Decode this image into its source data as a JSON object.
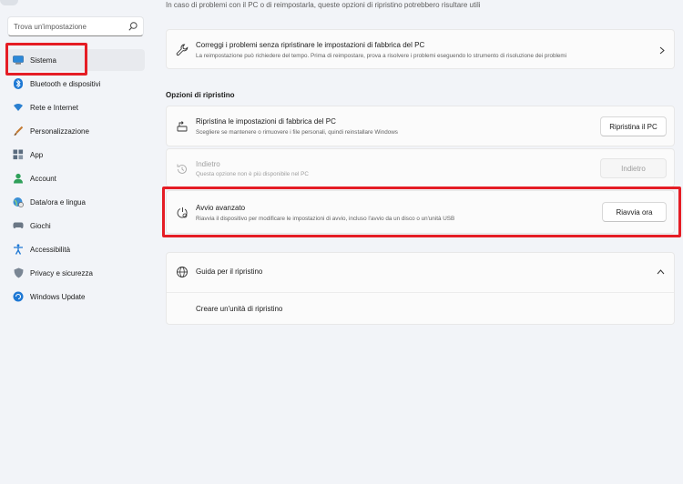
{
  "search": {
    "placeholder": "Trova un'impostazione"
  },
  "sidebar": {
    "items": [
      {
        "label": "Sistema",
        "icon": "monitor-icon"
      },
      {
        "label": "Bluetooth e dispositivi",
        "icon": "bluetooth-icon"
      },
      {
        "label": "Rete e Internet",
        "icon": "wifi-icon"
      },
      {
        "label": "Personalizzazione",
        "icon": "brush-icon"
      },
      {
        "label": "App",
        "icon": "apps-icon"
      },
      {
        "label": "Account",
        "icon": "account-icon"
      },
      {
        "label": "Data/ora e lingua",
        "icon": "globe-clock-icon"
      },
      {
        "label": "Giochi",
        "icon": "gamepad-icon"
      },
      {
        "label": "Accessibilità",
        "icon": "accessibility-icon"
      },
      {
        "label": "Privacy e sicurezza",
        "icon": "shield-icon"
      },
      {
        "label": "Windows Update",
        "icon": "update-icon"
      }
    ]
  },
  "main": {
    "intro": "In caso di problemi con il PC o di reimpostarla, queste opzioni di ripristino potrebbero risultare utili",
    "fix_card": {
      "title": "Correggi i problemi senza ripristinare le impostazioni di fabbrica del PC",
      "desc": "La reimpostazione può richiedere del tempo. Prima di reimpostare, prova a risolvere i problemi eseguendo lo strumento di risoluzione dei problemi"
    },
    "section_title": "Opzioni di ripristino",
    "reset_card": {
      "title": "Ripristina le impostazioni di fabbrica del PC",
      "desc": "Scegliere se mantenere o rimuovere i file personali, quindi reinstallare Windows",
      "button": "Ripristina il PC"
    },
    "back_card": {
      "title": "Indietro",
      "desc": "Questa opzione non è più disponibile nel PC",
      "button": "Indietro"
    },
    "advanced_card": {
      "title": "Avvio avanzato",
      "desc": "Riavvia il dispositivo per modificare le impostazioni di avvio, incluso l'avvio da un disco o un'unità USB",
      "button": "Riavvia ora"
    },
    "help_card": {
      "title": "Guida per il ripristino",
      "link": "Creare un'unità di ripristino"
    }
  },
  "colors": {
    "accent": "#0067c0",
    "highlight": "#e51d25"
  }
}
